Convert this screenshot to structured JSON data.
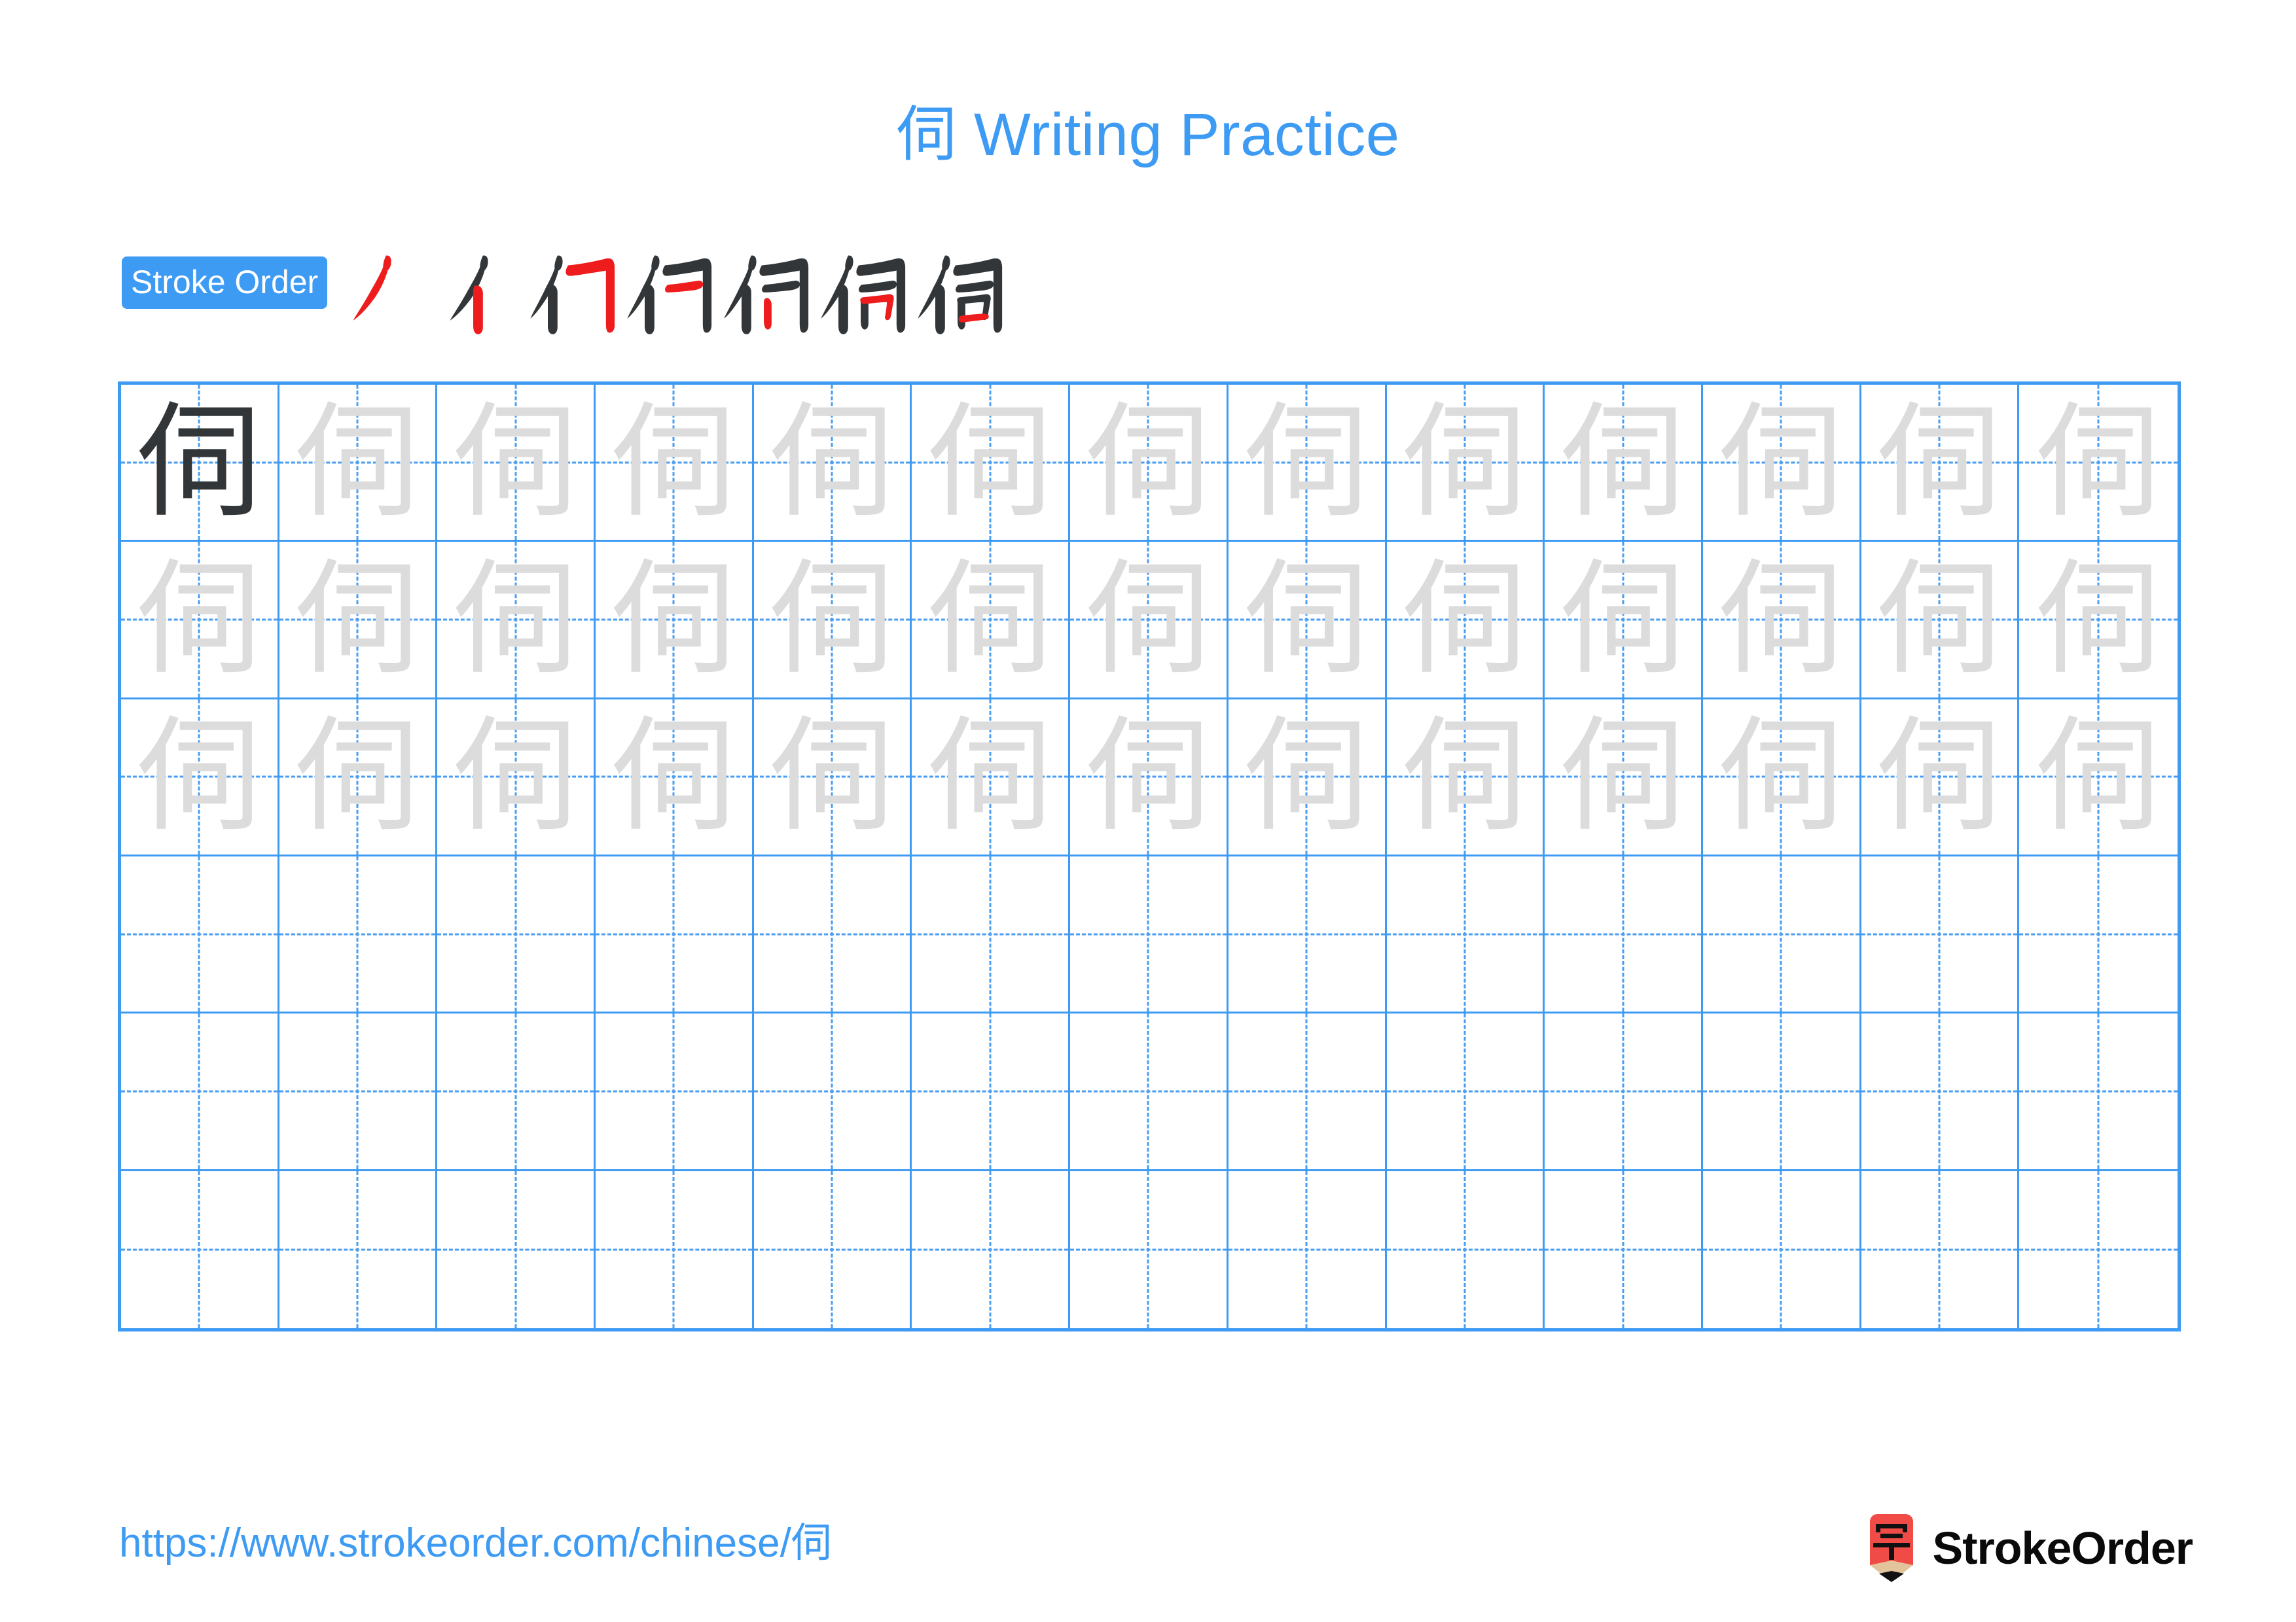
{
  "document": {
    "title": "伺 Writing Practice",
    "character": "伺",
    "title_prefix_char": "伺",
    "title_suffix": " Writing Practice"
  },
  "stroke_order": {
    "badge_label": "Stroke Order",
    "stroke_count": 7,
    "new_stroke_color": "#ee1c1c",
    "prior_stroke_color": "#333638",
    "steps": [
      {
        "index": 1,
        "strokes_shown": 1,
        "glyph": "丿"
      },
      {
        "index": 2,
        "strokes_shown": 2,
        "glyph": "亻"
      },
      {
        "index": 3,
        "strokes_shown": 3,
        "glyph": "彳"
      },
      {
        "index": 4,
        "strokes_shown": 4,
        "glyph": "彳"
      },
      {
        "index": 5,
        "strokes_shown": 5,
        "glyph": "伺"
      },
      {
        "index": 6,
        "strokes_shown": 6,
        "glyph": "伺"
      },
      {
        "index": 7,
        "strokes_shown": 7,
        "glyph": "伺"
      }
    ]
  },
  "practice_grid": {
    "columns": 13,
    "rows": 6,
    "grid_line_color": "#3d9bf4",
    "guide_line_color": "#4a9df2",
    "dark_glyph_color": "#333638",
    "trace_glyph_color": "#dcdcdc",
    "cells": [
      [
        "伺",
        "伺",
        "伺",
        "伺",
        "伺",
        "伺",
        "伺",
        "伺",
        "伺",
        "伺",
        "伺",
        "伺",
        "伺"
      ],
      [
        "伺",
        "伺",
        "伺",
        "伺",
        "伺",
        "伺",
        "伺",
        "伺",
        "伺",
        "伺",
        "伺",
        "伺",
        "伺"
      ],
      [
        "伺",
        "伺",
        "伺",
        "伺",
        "伺",
        "伺",
        "伺",
        "伺",
        "伺",
        "伺",
        "伺",
        "伺",
        "伺"
      ],
      [
        "",
        "",
        "",
        "",
        "",
        "",
        "",
        "",
        "",
        "",
        "",
        "",
        ""
      ],
      [
        "",
        "",
        "",
        "",
        "",
        "",
        "",
        "",
        "",
        "",
        "",
        "",
        ""
      ],
      [
        "",
        "",
        "",
        "",
        "",
        "",
        "",
        "",
        "",
        "",
        "",
        "",
        ""
      ]
    ],
    "dark_cell": {
      "row": 0,
      "col": 0
    }
  },
  "footer": {
    "url": "https://www.strokeorder.com/chinese/伺",
    "url_base": "https://www.strokeorder.com/chinese/",
    "url_char": "伺",
    "brand_name": "StrokeOrder",
    "brand_mark_char": "字",
    "brand_mark_color": "#f04b46",
    "brand_mark_tip_color": "#e3c39b"
  },
  "colors": {
    "accent_blue": "#3d9bf4",
    "text_dark": "#333638",
    "trace_gray": "#dcdcdc",
    "stroke_red": "#ee1c1c",
    "brand_red": "#f04b46"
  }
}
